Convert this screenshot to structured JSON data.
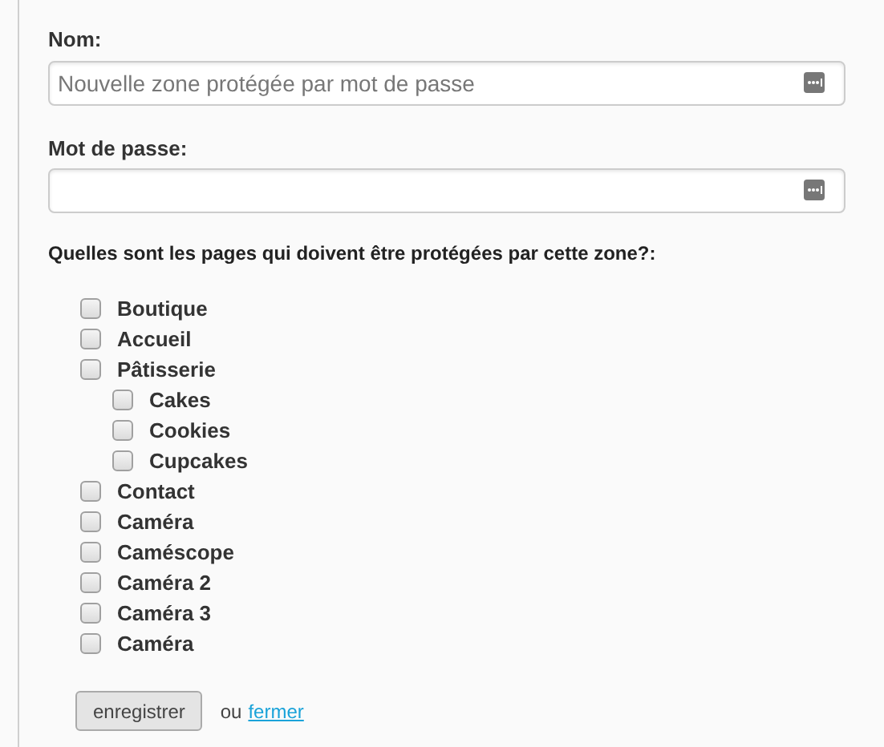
{
  "fields": [
    {
      "label": "Nom:",
      "placeholder": "Nouvelle zone protégée par mot de passe"
    },
    {
      "label": "Mot de passe:"
    }
  ],
  "pages_heading": "Quelles sont les pages qui doivent être protégées par cette zone?:",
  "pages": [
    {
      "label": "Boutique",
      "checked": false
    },
    {
      "label": "Accueil",
      "checked": false
    },
    {
      "label": "Pâtisserie",
      "checked": false,
      "children": [
        {
          "label": "Cakes",
          "checked": false
        },
        {
          "label": "Cookies",
          "checked": false
        },
        {
          "label": "Cupcakes",
          "checked": false
        }
      ]
    },
    {
      "label": "Contact",
      "checked": false
    },
    {
      "label": "Caméra",
      "checked": false
    },
    {
      "label": "Caméscope",
      "checked": false
    },
    {
      "label": "Caméra 2",
      "checked": false
    },
    {
      "label": "Caméra 3",
      "checked": false
    },
    {
      "label": "Caméra",
      "checked": false
    }
  ],
  "save_button": "enregistrer",
  "or_text": "ou",
  "close_link": "fermer"
}
